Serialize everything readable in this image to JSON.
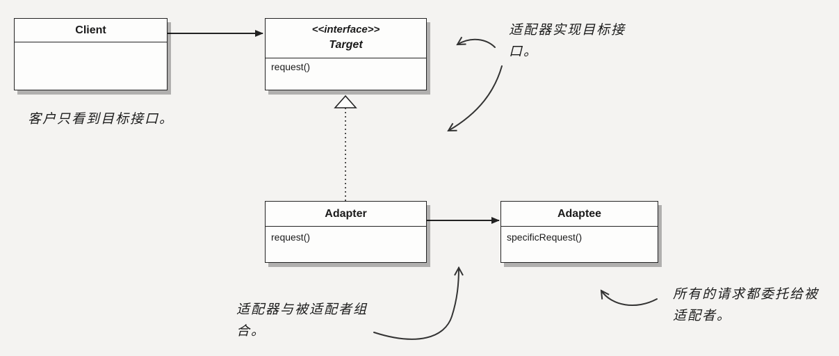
{
  "diagram": {
    "client": {
      "name": "Client"
    },
    "target": {
      "stereotype": "<<interface>>",
      "name": "Target",
      "operation": "request()"
    },
    "adapter": {
      "name": "Adapter",
      "operation": "request()"
    },
    "adaptee": {
      "name": "Adaptee",
      "operation": "specificRequest()"
    }
  },
  "annotations": {
    "client_note": "客户只看到目标接口。",
    "adapter_impl_note": "适配器实现目标接口。",
    "composition_note": "适配器与被适配者组合。",
    "delegation_note": "所有的请求都委托给被适配者。"
  },
  "colors": {
    "ink": "#222222",
    "page": "#f4f3f1",
    "box": "#fdfdfc"
  }
}
